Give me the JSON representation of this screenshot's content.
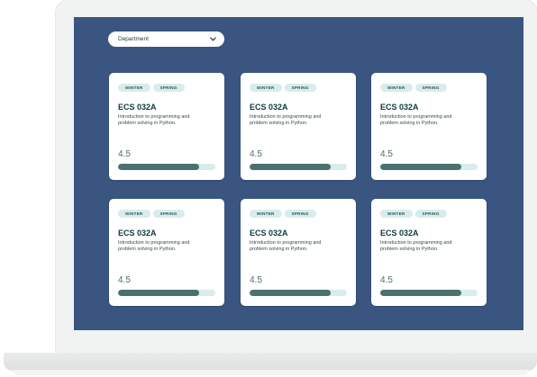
{
  "filters": {
    "department_label": "Department"
  },
  "rating_max": 5,
  "colors": {
    "screen_background": "#3a5580",
    "card_background": "#ffffff",
    "tag_background": "#d8ecec",
    "rating_fill": "#4a716f",
    "rating_track": "#d8ecec"
  },
  "icons": {
    "dropdown": "chevron-down-icon"
  },
  "courses": [
    {
      "tags": [
        "WINTER",
        "SPRING"
      ],
      "code": "ECS 032A",
      "description": "Introduction to programming and problem solving in Python.",
      "rating": "4.5",
      "rating_fraction": 0.83
    },
    {
      "tags": [
        "WINTER",
        "SPRING"
      ],
      "code": "ECS 032A",
      "description": "Introduction to programming and problem solving in Python.",
      "rating": "4.5",
      "rating_fraction": 0.83
    },
    {
      "tags": [
        "WINTER",
        "SPRING"
      ],
      "code": "ECS 032A",
      "description": "Introduction to programming and problem solving in Python.",
      "rating": "4.5",
      "rating_fraction": 0.83
    },
    {
      "tags": [
        "WINTER",
        "SPRING"
      ],
      "code": "ECS 032A",
      "description": "Introduction to programming and problem solving in Python.",
      "rating": "4.5",
      "rating_fraction": 0.83
    },
    {
      "tags": [
        "WINTER",
        "SPRING"
      ],
      "code": "ECS 032A",
      "description": "Introduction to programming and problem solving in Python.",
      "rating": "4.5",
      "rating_fraction": 0.83
    },
    {
      "tags": [
        "WINTER",
        "SPRING"
      ],
      "code": "ECS 032A",
      "description": "Introduction to programming and problem solving in Python.",
      "rating": "4.5",
      "rating_fraction": 0.83
    }
  ]
}
